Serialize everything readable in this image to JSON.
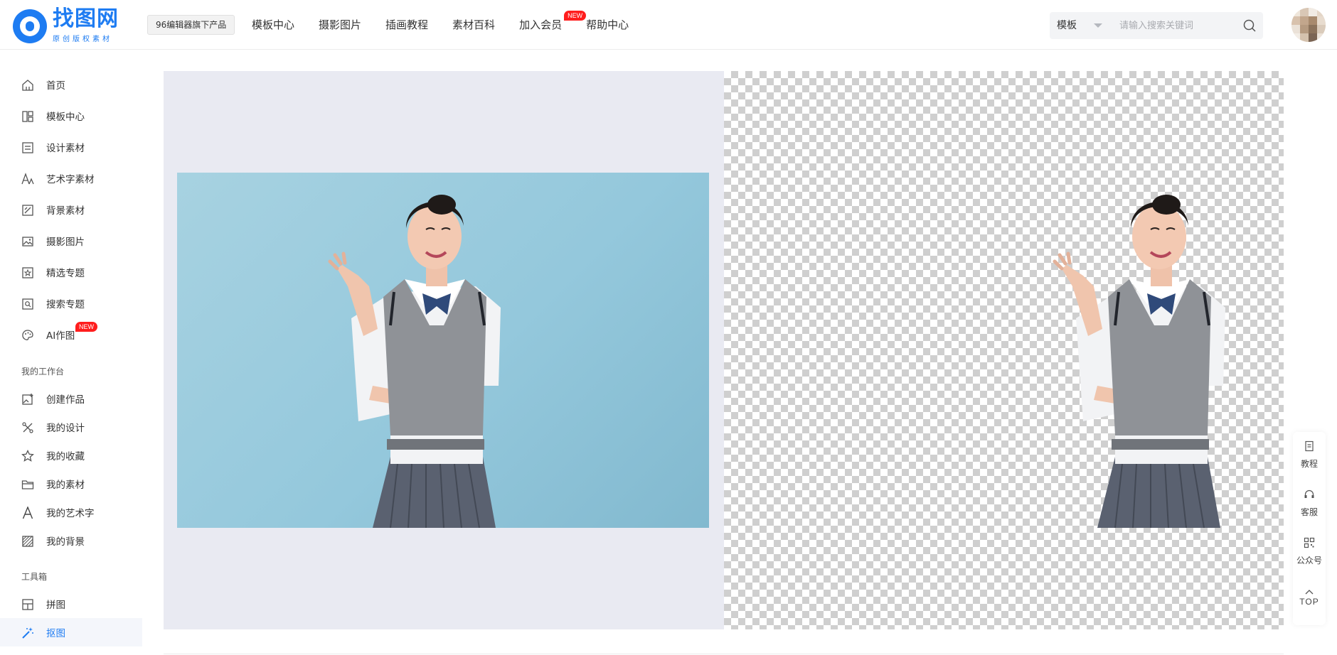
{
  "header": {
    "logo_title": "找图网",
    "logo_sub": "原创版权素材",
    "product_tag": "96编辑器旗下产品",
    "nav": [
      {
        "label": "模板中心"
      },
      {
        "label": "摄影图片"
      },
      {
        "label": "插画教程"
      },
      {
        "label": "素材百科"
      },
      {
        "label": "加入会员",
        "badge": "NEW"
      },
      {
        "label": "帮助中心"
      }
    ],
    "search": {
      "category": "模板",
      "placeholder": "请输入搜索关键词"
    }
  },
  "sidebar": {
    "items": [
      {
        "label": "首页",
        "icon": "home-icon"
      },
      {
        "label": "模板中心",
        "icon": "template-icon"
      },
      {
        "label": "设计素材",
        "icon": "material-icon"
      },
      {
        "label": "艺术字素材",
        "icon": "art-text-icon"
      },
      {
        "label": "背景素材",
        "icon": "background-icon"
      },
      {
        "label": "摄影图片",
        "icon": "photo-icon"
      },
      {
        "label": "精选专题",
        "icon": "star-topic-icon"
      },
      {
        "label": "搜索专题",
        "icon": "search-topic-icon"
      },
      {
        "label": "AI作图",
        "icon": "palette-icon",
        "badge": "NEW"
      }
    ],
    "workspace_title": "我的工作台",
    "workspace": [
      {
        "label": "创建作品",
        "icon": "create-icon"
      },
      {
        "label": "我的设计",
        "icon": "design-icon"
      },
      {
        "label": "我的收藏",
        "icon": "star-icon"
      },
      {
        "label": "我的素材",
        "icon": "folder-icon"
      },
      {
        "label": "我的艺术字",
        "icon": "letter-a-icon"
      },
      {
        "label": "我的背景",
        "icon": "hatch-icon"
      }
    ],
    "tools_title": "工具箱",
    "tools": [
      {
        "label": "拼图",
        "icon": "collage-icon"
      },
      {
        "label": "抠图",
        "icon": "magic-wand-icon",
        "active": true
      }
    ]
  },
  "float_bar": {
    "items": [
      {
        "label": "教程",
        "icon": "document-icon"
      },
      {
        "label": "客服",
        "icon": "headset-icon"
      },
      {
        "label": "公众号",
        "icon": "qrcode-icon"
      },
      {
        "label": "TOP",
        "icon": "arrow-up-icon"
      }
    ]
  },
  "colors": {
    "accent": "#1e7cf2",
    "badge": "#ff1d1d",
    "photo_bg": "#94c8dc"
  }
}
